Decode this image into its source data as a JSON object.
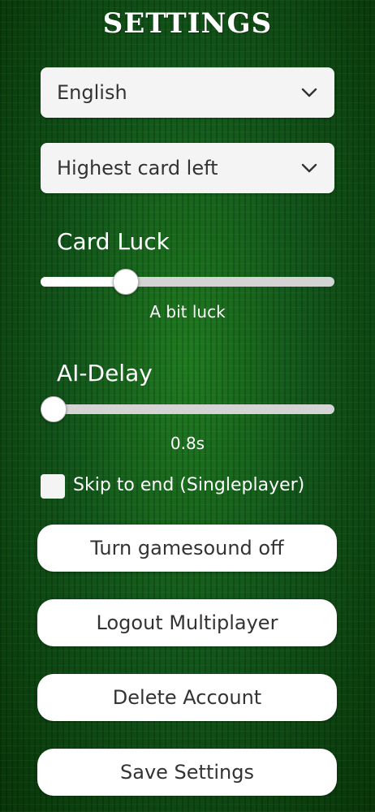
{
  "header": {
    "title": "SETTINGS"
  },
  "language_select": {
    "value": "English",
    "icon": "chevron-down-icon"
  },
  "card_order_select": {
    "value": "Highest card left",
    "icon": "chevron-down-icon"
  },
  "card_luck": {
    "label": "Card Luck",
    "value_text": "A bit luck",
    "level_fraction": 0.27
  },
  "ai_delay": {
    "label": "AI-Delay",
    "value_text": "0.8s",
    "level_fraction": 0.0
  },
  "skip_to_end": {
    "label": "Skip to end (Singleplayer)",
    "checked": false
  },
  "buttons": {
    "gamesound": "Turn gamesound off",
    "logout": "Logout Multiplayer",
    "delete": "Delete Account",
    "save": "Save Settings"
  },
  "colors": {
    "background": "#0f4a0f",
    "control_surface": "#f4f4f4",
    "text_light": "#ffffff",
    "text_dark": "#333333"
  }
}
